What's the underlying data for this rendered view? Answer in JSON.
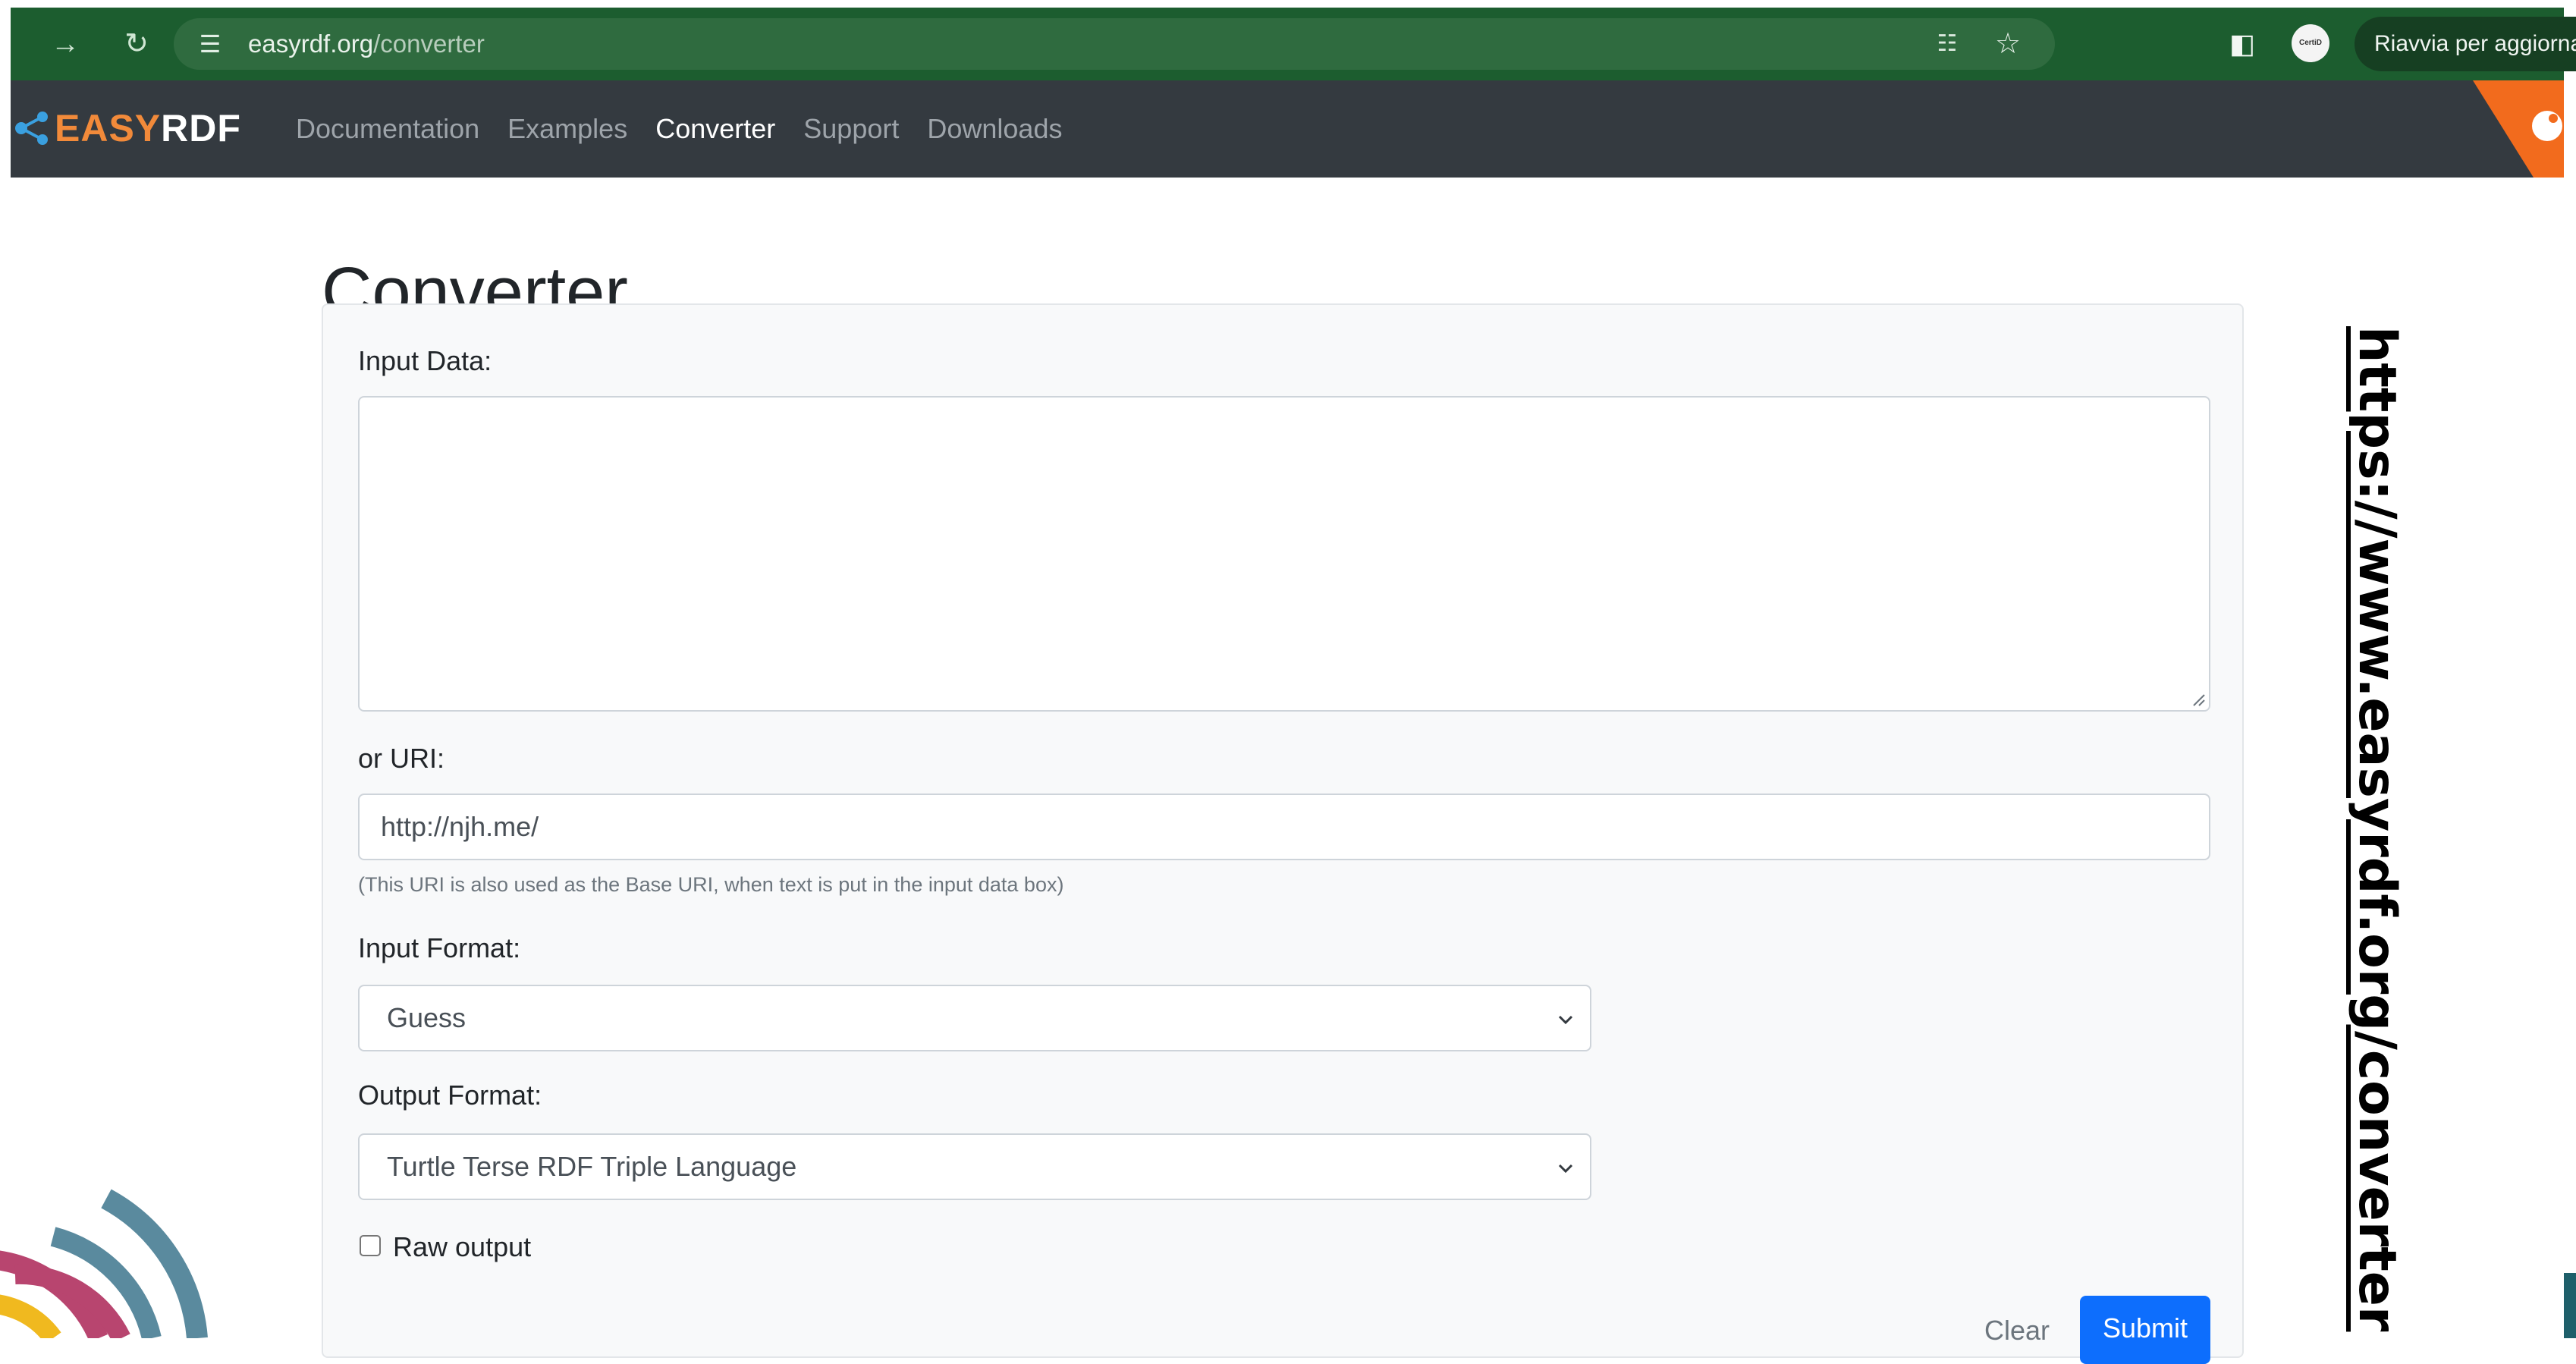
{
  "browser": {
    "url_domain": "easyrdf.org",
    "url_path": "/converter",
    "restart_label": "Riavvia per aggiornare",
    "avatar_label": "CertiD",
    "icons": [
      "arrow-right-icon",
      "reload-icon",
      "tune-icon",
      "translate-icon",
      "star-icon",
      "side-panel-icon"
    ]
  },
  "navbar": {
    "brand_easy": "EASY",
    "brand_rdf": "RDF",
    "links": [
      "Documentation",
      "Examples",
      "Converter",
      "Support",
      "Downloads"
    ],
    "active_link": "Converter"
  },
  "page": {
    "title": "Converter"
  },
  "form": {
    "input_data_label": "Input Data:",
    "input_data_value": "",
    "uri_label": "or URI:",
    "uri_value": "http://njh.me/",
    "uri_hint": "(This URI is also used as the Base URI, when text is put in the input data box)",
    "input_format_label": "Input Format:",
    "input_format_selected": "Guess",
    "output_format_label": "Output Format:",
    "output_format_selected": "Turtle Terse RDF Triple Language",
    "raw_output_label": "Raw output",
    "raw_output_checked": false,
    "clear_label": "Clear",
    "submit_label": "Submit"
  },
  "caption": {
    "url": "https://www.easyrdf.org/converter"
  },
  "colors": {
    "browser_bar": "#1c5d2f",
    "navbar": "#343a40",
    "brand_orange": "#f28a3a",
    "submit_blue": "#0d6efd"
  }
}
